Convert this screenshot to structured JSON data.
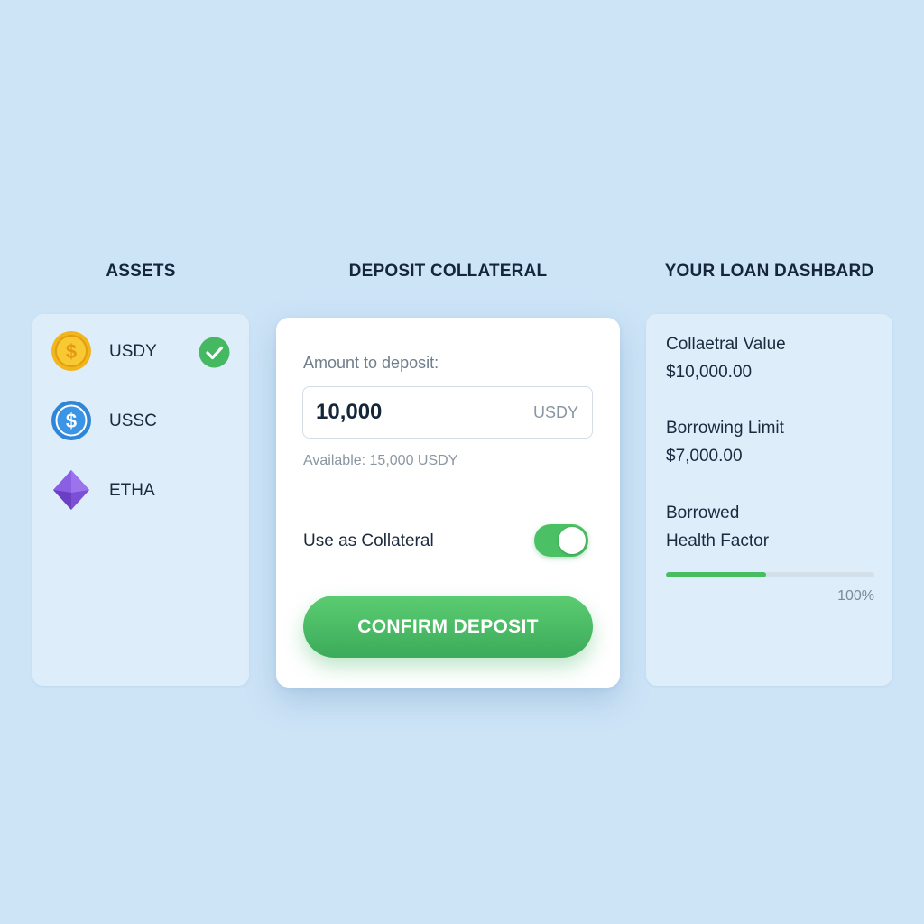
{
  "columns": {
    "assets_title": "ASSETS",
    "deposit_title": "DEPOSIT COLLATERAL",
    "dashboard_title": "YOUR LOAN DASHBARD"
  },
  "assets": [
    {
      "label": "USDY",
      "icon": "usdy-coin-icon",
      "color": "#f2b51c",
      "selected": true
    },
    {
      "label": "USSC",
      "icon": "ussc-coin-icon",
      "color": "#2f86d8",
      "selected": false
    },
    {
      "label": "ETHA",
      "icon": "etha-diamond-icon",
      "color": "#7c4fd6",
      "selected": false
    }
  ],
  "deposit": {
    "amount_label": "Amount to deposit:",
    "amount_value": "10,000",
    "amount_unit": "USDY",
    "available": "Available: 15,000 USDY",
    "collateral_label": "Use as Collateral",
    "collateral_enabled": true,
    "confirm_label": "CONFIRM DEPOSIT"
  },
  "dashboard": {
    "collateral_label": "Collaetral Value",
    "collateral_value": "$10,000.00",
    "limit_label": "Borrowing Limit",
    "limit_value": "$7,000.00",
    "borrowed_label": "Borrowed",
    "health_label": "Health Factor",
    "health_fill_fraction": 0.48,
    "health_percent": "100%"
  },
  "colors": {
    "background": "#cde4f7",
    "accent_green": "#4cc064",
    "text_dark": "#15263b"
  }
}
